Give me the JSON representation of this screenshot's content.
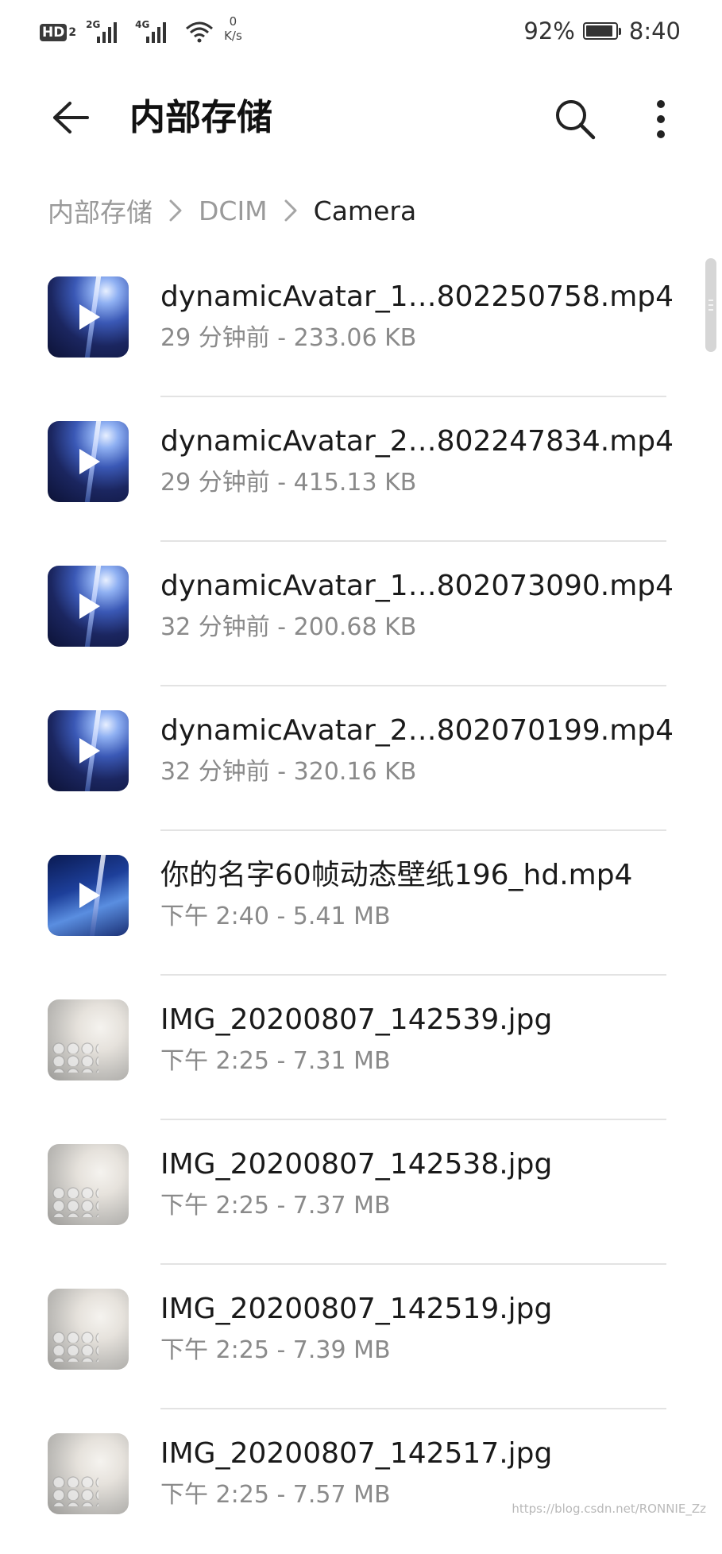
{
  "status_bar": {
    "hd": "HD",
    "hd_sim": "2",
    "net1": "2G",
    "net2": "4G",
    "speed_value": "0",
    "speed_unit": "K/s",
    "battery": "92%",
    "time": "8:40"
  },
  "header": {
    "title": "内部存储"
  },
  "breadcrumb": [
    "内部存储",
    "DCIM",
    "Camera"
  ],
  "files": [
    {
      "name": "dynamicAvatar_1…802250758.mp4",
      "meta": "29 分钟前 - 233.06 KB",
      "kind": "video"
    },
    {
      "name": "dynamicAvatar_2…802247834.mp4",
      "meta": "29 分钟前 - 415.13 KB",
      "kind": "video"
    },
    {
      "name": "dynamicAvatar_1…802073090.mp4",
      "meta": "32 分钟前 - 200.68 KB",
      "kind": "video"
    },
    {
      "name": "dynamicAvatar_2…802070199.mp4",
      "meta": "32 分钟前 - 320.16 KB",
      "kind": "video"
    },
    {
      "name": "你的名字60帧动态壁纸196_hd.mp4",
      "meta": "下午 2:40  - 5.41 MB",
      "kind": "video2"
    },
    {
      "name": "IMG_20200807_142539.jpg",
      "meta": "下午 2:25  - 7.31 MB",
      "kind": "photo"
    },
    {
      "name": "IMG_20200807_142538.jpg",
      "meta": "下午 2:25  - 7.37 MB",
      "kind": "photo"
    },
    {
      "name": "IMG_20200807_142519.jpg",
      "meta": "下午 2:25  - 7.39 MB",
      "kind": "photo"
    },
    {
      "name": "IMG_20200807_142517.jpg",
      "meta": "下午 2:25  - 7.57 MB",
      "kind": "photo"
    }
  ],
  "battery_level": 0.92,
  "watermark": "https://blog.csdn.net/RONNIE_Zz",
  "colors": {
    "text_primary": "#1a1a1a",
    "text_secondary": "#8a8a8a",
    "breadcrumb_inactive": "#9a9a9a",
    "divider": "#e3e3e3"
  }
}
